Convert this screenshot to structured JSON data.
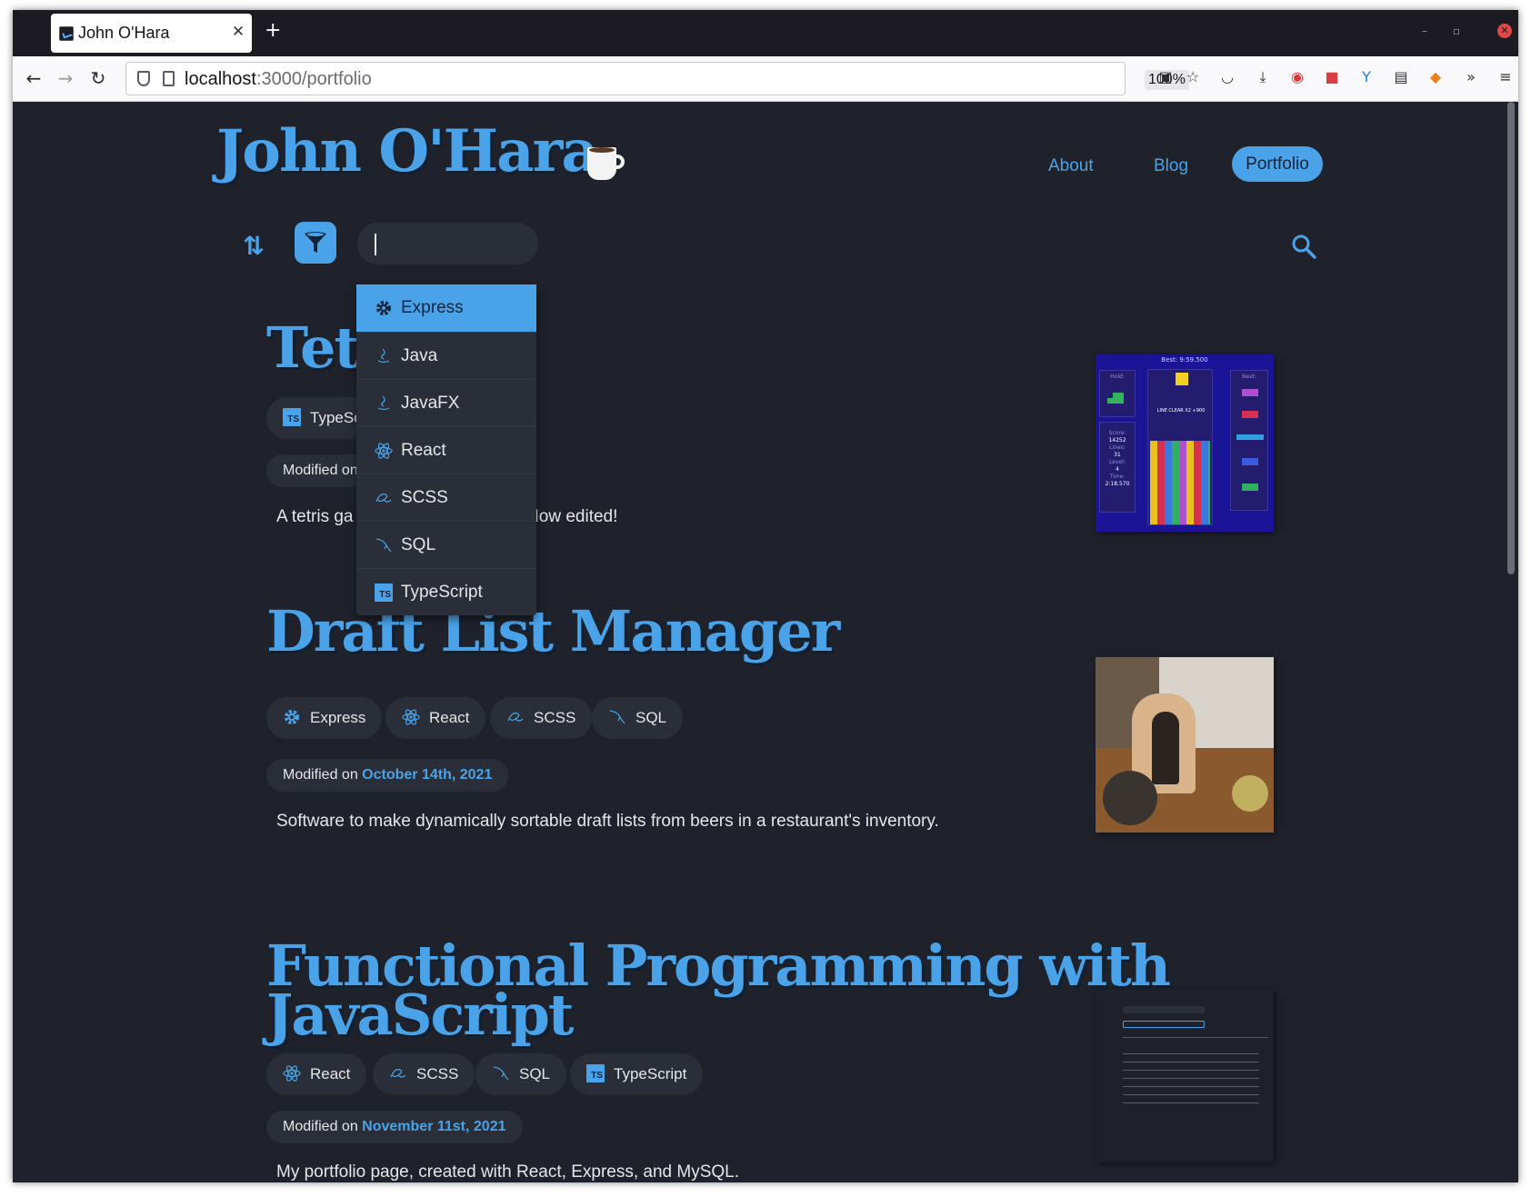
{
  "browser": {
    "tab_title": "John O'Hara",
    "new_tab": "+",
    "url_host": "localhost",
    "url_path": ":3000/portfolio",
    "zoom": "100%"
  },
  "site": {
    "title": "John O'Hara",
    "nav": {
      "about": "About",
      "blog": "Blog",
      "portfolio": "Portfolio"
    }
  },
  "filter": {
    "search_value": "",
    "options": [
      "Express",
      "Java",
      "JavaFX",
      "React",
      "SCSS",
      "SQL",
      "TypeScript"
    ],
    "highlighted": "Express"
  },
  "projects": [
    {
      "title": "Tetris",
      "tags": [
        "TypeScript"
      ],
      "modified_prefix": "Modified on",
      "modified_date": "",
      "description_start": "A tetris ga",
      "description_end": ". Now edited!",
      "thumb_text": {
        "best": "Best: 9:59.500",
        "hold": "Hold:",
        "next": "Next:",
        "score_label": "Score:",
        "score": "14252",
        "lines_label": "Lines:",
        "lines": "31",
        "level_label": "Level:",
        "level": "4",
        "time_label": "Time:",
        "time": "2:18.570",
        "banner": "LINE CLEAR X2 +900"
      }
    },
    {
      "title": "Draft List Manager",
      "tags": [
        "Express",
        "React",
        "SCSS",
        "SQL"
      ],
      "modified_prefix": "Modified on",
      "modified_date": "October 14th, 2021",
      "description": "Software to make dynamically sortable draft lists from beers in a restaurant's inventory."
    },
    {
      "title_line1": "Functional Programming with",
      "title_line2": "JavaScript",
      "tags": [
        "React",
        "SCSS",
        "SQL",
        "TypeScript"
      ],
      "modified_prefix": "Modified on",
      "modified_date": "November 11st, 2021",
      "description": "My portfolio page, created with React, Express, and MySQL."
    }
  ],
  "colors": {
    "accent": "#4aa3e8",
    "page_bg": "#1f222b",
    "chip_bg": "#2a2e38"
  }
}
